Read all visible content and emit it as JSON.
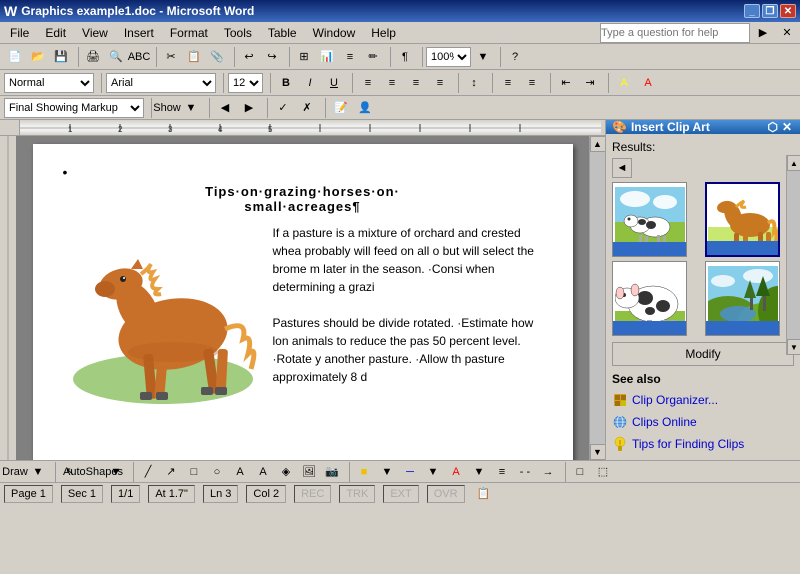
{
  "titleBar": {
    "title": "Graphics example1.doc - Microsoft Word",
    "icon": "word-icon",
    "buttons": [
      "minimize",
      "restore",
      "close"
    ]
  },
  "menuBar": {
    "items": [
      "File",
      "Edit",
      "View",
      "Insert",
      "Format",
      "Tools",
      "Table",
      "Window",
      "Help"
    ]
  },
  "toolbar1": {
    "zoom": "100%",
    "searchPlaceholder": "Type a question for help"
  },
  "formattingBar": {
    "style": "Normal",
    "font": "Arial",
    "size": "12",
    "boldLabel": "B",
    "italicLabel": "I",
    "underlineLabel": "U"
  },
  "trackingBar": {
    "mode": "Final Showing Markup",
    "showLabel": "Show"
  },
  "document": {
    "title": "Tips·on·grazing·horses·on·\nsmall·acreages¶",
    "bullet": "•",
    "paragraph1": "If a pasture is a mixture of orchard and crested whea probably will feed on all o but will select the brome m later in the season. ·Consi when determining a grazi",
    "paragraph2": "Pastures should be divide rotated. ·Estimate how lon animals to reduce the pas 50 percent level. ·Rotate y another pasture. ·Allow th pasture approximately 8 d"
  },
  "clipArtPanel": {
    "title": "Insert Clip Art",
    "resultsLabel": "Results:",
    "backBtnLabel": "◄",
    "modifyLabel": "Modify",
    "seeAlsoLabel": "See also",
    "links": [
      {
        "label": "Clip Organizer...",
        "icon": "organizer-icon"
      },
      {
        "label": "Clips Online",
        "icon": "globe-icon"
      },
      {
        "label": "Tips for Finding Clips",
        "icon": "tips-icon"
      }
    ]
  },
  "statusBar": {
    "page": "Page 1",
    "sec": "Sec 1",
    "pageOf": "1/1",
    "at": "At 1.7\"",
    "ln": "Ln 3",
    "col": "Col 2",
    "rec": "REC",
    "trk": "TRK",
    "ext": "EXT",
    "ovr": "OVR"
  },
  "drawToolbar": {
    "drawLabel": "Draw",
    "autoShapesLabel": "AutoShapes"
  }
}
